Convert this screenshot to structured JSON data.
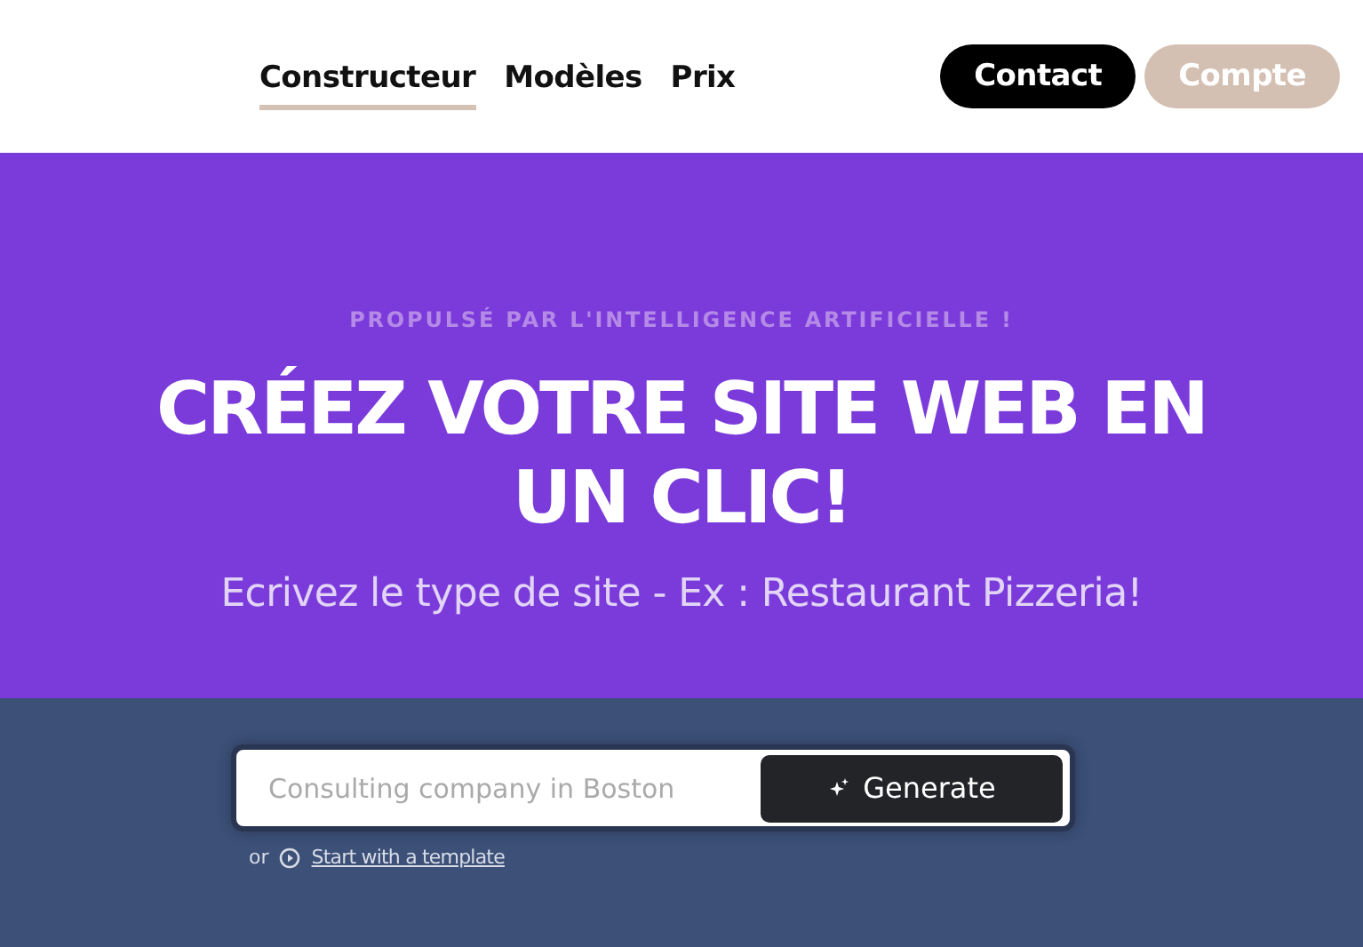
{
  "nav": {
    "tabs": [
      {
        "label": "Constructeur",
        "selected": true
      },
      {
        "label": "Modèles",
        "selected": false
      },
      {
        "label": "Prix",
        "selected": false
      }
    ],
    "buttons": [
      {
        "label": "Contact",
        "kind": "primary"
      },
      {
        "label": "Compte",
        "kind": "secondary"
      }
    ]
  },
  "hero": {
    "eyebrow": "PROPULSÉ PAR L'INTELLIGENCE ARTIFICIELLE !",
    "title": "CRÉEZ VOTRE SITE WEB EN UN CLIC!",
    "subtitle": "Ecrivez le type de site - Ex : Restaurant Pizzeria!"
  },
  "prompt": {
    "placeholder": "Consulting company in Boston",
    "button": "Generate",
    "or": "or",
    "template_link": "Start with a template"
  }
}
